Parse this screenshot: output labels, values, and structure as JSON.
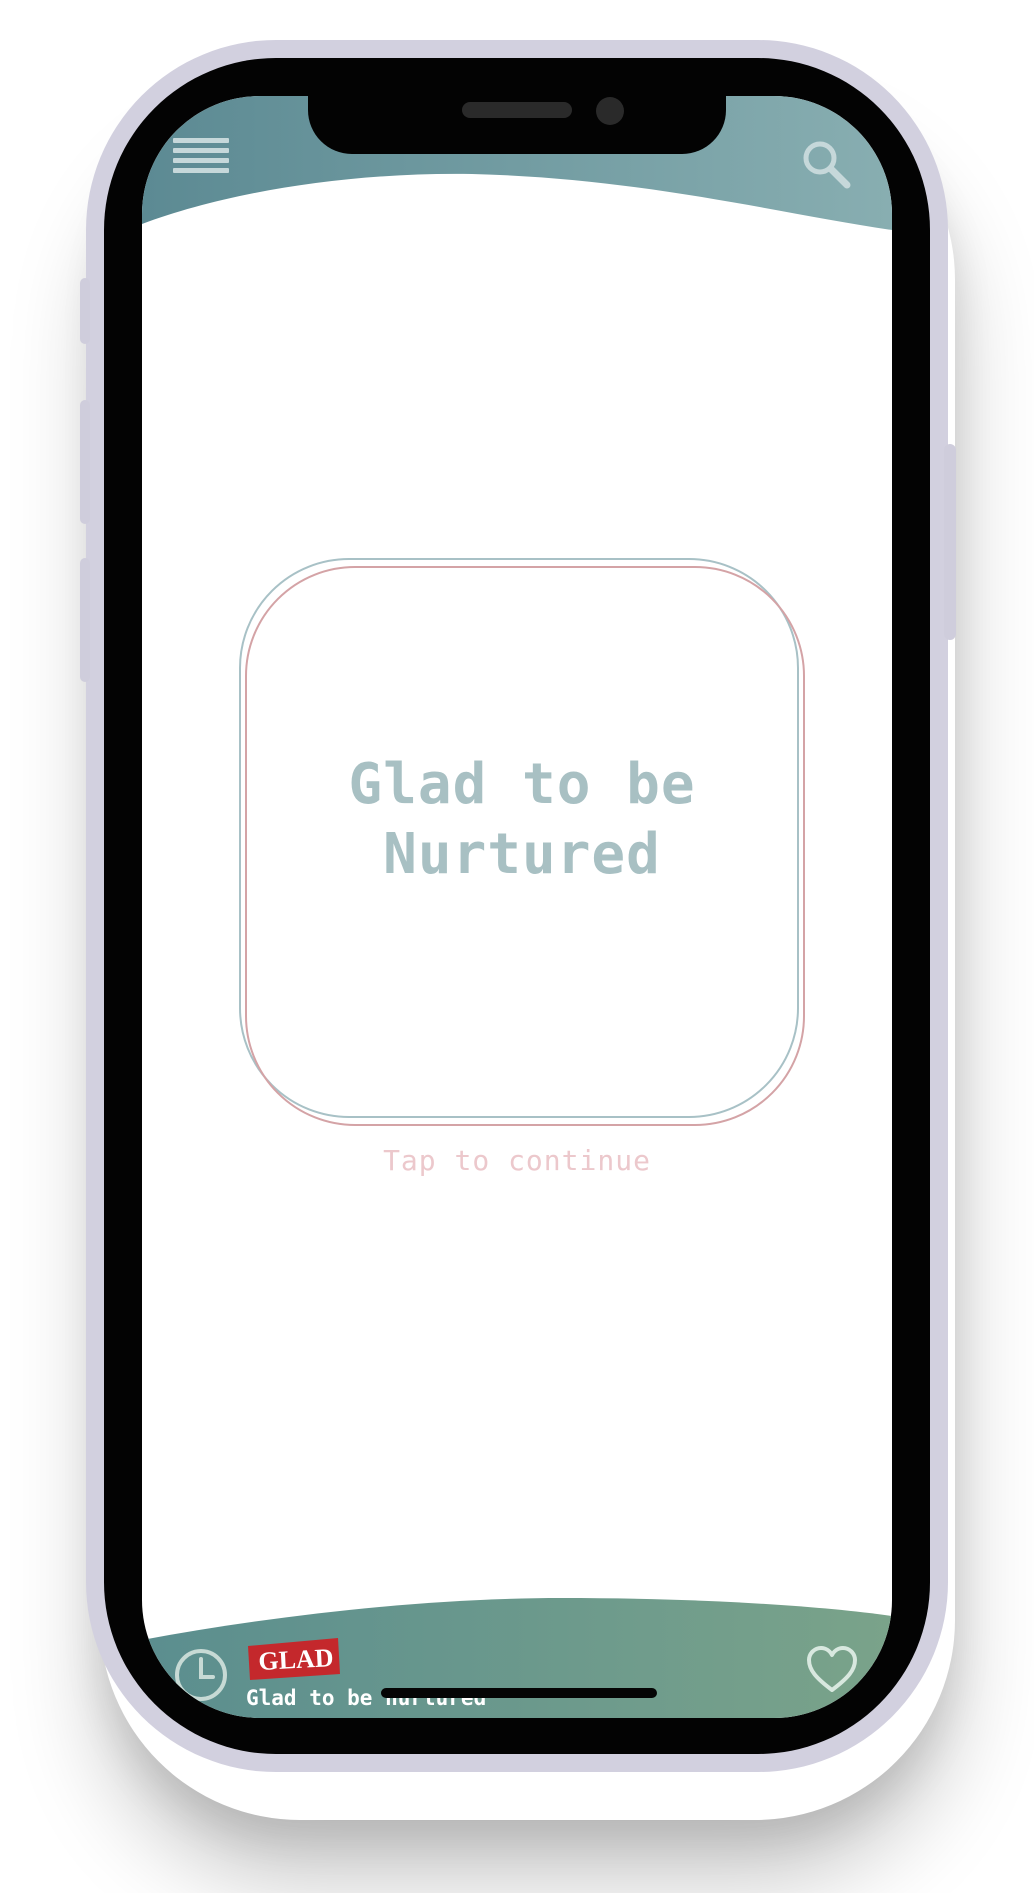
{
  "header": {
    "menu_icon": "hamburger-menu-icon",
    "search_icon": "search-icon",
    "gradient_start": "#5c8a93",
    "gradient_end": "#88aeb1"
  },
  "card": {
    "title_line1": "Glad to be",
    "title_line2": "Nurtured",
    "title_color": "#a8c0c3",
    "ring_blue": "#a8c1c6",
    "ring_red": "#d4a3a6"
  },
  "hint": {
    "text": "Tap to continue",
    "color": "#ecc8cc"
  },
  "footer": {
    "history_icon": "clock-icon",
    "favorite_icon": "heart-icon",
    "brand_logo_text": "GLAD",
    "brand_tagline": "Glad to be nurtured",
    "gradient_start": "#5b8e8f",
    "gradient_end": "#7aa38a",
    "brand_color": "#c4282c"
  }
}
